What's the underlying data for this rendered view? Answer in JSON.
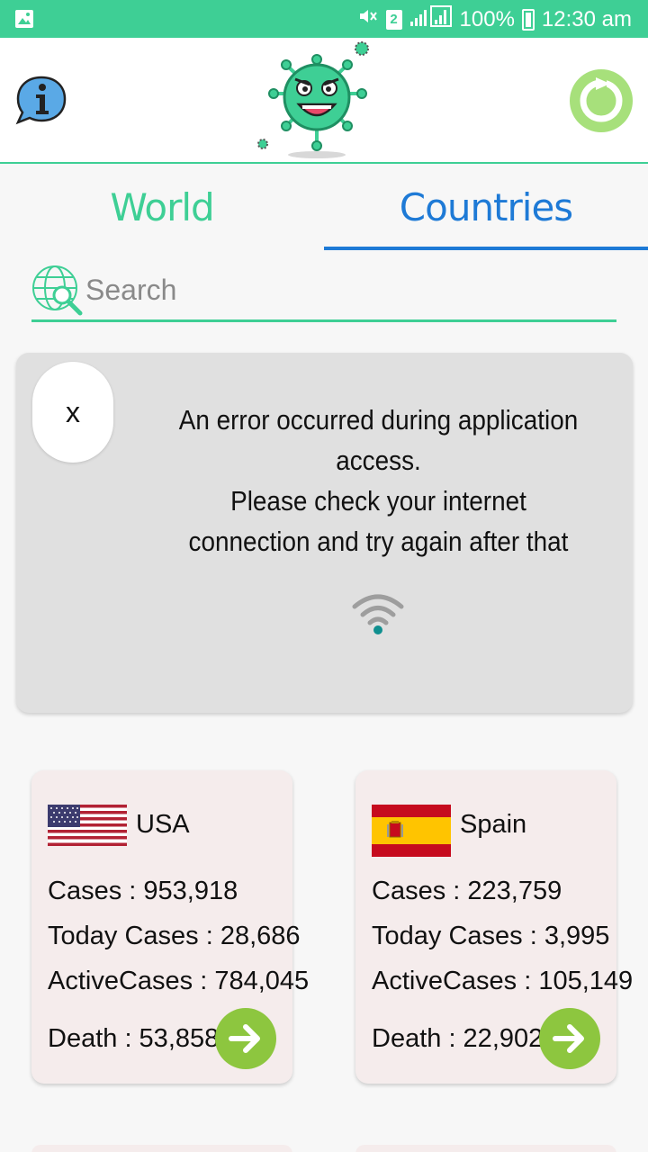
{
  "status_bar": {
    "gallery_icon": "image-icon",
    "sim_badge": "2",
    "battery": "100%",
    "time": "12:30 am"
  },
  "header": {
    "info_icon": "info-icon",
    "logo_icon": "virus-mascot-icon",
    "refresh_icon": "refresh-icon"
  },
  "tabs": [
    {
      "label": "World",
      "active": false
    },
    {
      "label": "Countries",
      "active": true
    }
  ],
  "search": {
    "placeholder": "Search",
    "value": "",
    "icon": "globe-search-icon"
  },
  "error_card": {
    "close_label": "x",
    "line1": "An error occurred during application access.",
    "line2": "Please check your internet connection and try again after that",
    "wifi_icon": "wifi-icon"
  },
  "countries": [
    {
      "name": "USA",
      "flag_icon": "usa-flag-icon",
      "cases": "Cases : 953,918",
      "today_cases": "Today Cases : 28,686",
      "active_cases": "ActiveCases : 784,045",
      "death": "Death : 53,858"
    },
    {
      "name": "Spain",
      "flag_icon": "spain-flag-icon",
      "cases": "Cases : 223,759",
      "today_cases": "Today Cases : 3,995",
      "active_cases": "ActiveCases : 105,149",
      "death": "Death : 22,902"
    }
  ],
  "colors": {
    "accent_green": "#3ecf95",
    "tab_blue": "#1e7ad6",
    "button_green": "#8dc63f",
    "card_bg": "#f5ecec",
    "error_bg": "#e0e0e0"
  }
}
